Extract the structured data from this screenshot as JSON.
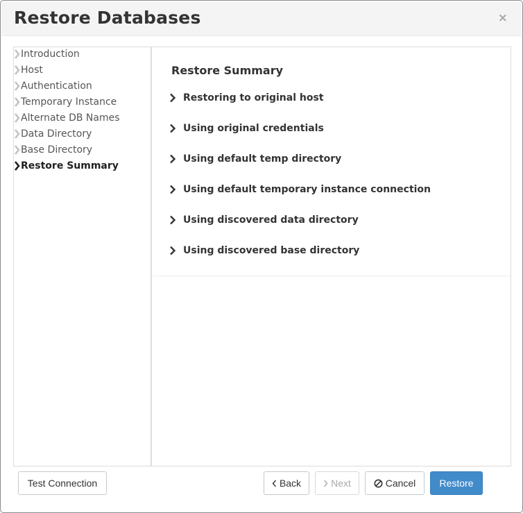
{
  "dialog": {
    "title": "Restore Databases",
    "close_glyph": "×"
  },
  "nav": {
    "items": [
      {
        "label": "Introduction",
        "active": false
      },
      {
        "label": "Host",
        "active": false
      },
      {
        "label": "Authentication",
        "active": false
      },
      {
        "label": "Temporary Instance",
        "active": false
      },
      {
        "label": "Alternate DB Names",
        "active": false
      },
      {
        "label": "Data Directory",
        "active": false
      },
      {
        "label": "Base Directory",
        "active": false
      },
      {
        "label": "Restore Summary",
        "active": true
      }
    ]
  },
  "summary": {
    "title": "Restore Summary",
    "items": [
      "Restoring to original host",
      "Using original credentials",
      "Using default temp directory",
      "Using default temporary instance connection",
      "Using discovered data directory",
      "Using discovered base directory"
    ]
  },
  "footer": {
    "test_connection": "Test Connection",
    "back": "Back",
    "next": "Next",
    "cancel": "Cancel",
    "restore": "Restore"
  },
  "icons": {
    "nav_chevron": "chevron-right-icon",
    "summary_chevron": "chevron-right-icon",
    "back": "chevron-left-icon",
    "next": "chevron-right-icon",
    "cancel": "ban-icon",
    "close": "close-icon"
  },
  "colors": {
    "primary": "#428bca",
    "active_nav": "#222222",
    "inactive_nav_chevron": "#c4c4c4",
    "header_bg": "#f4f4f4"
  }
}
